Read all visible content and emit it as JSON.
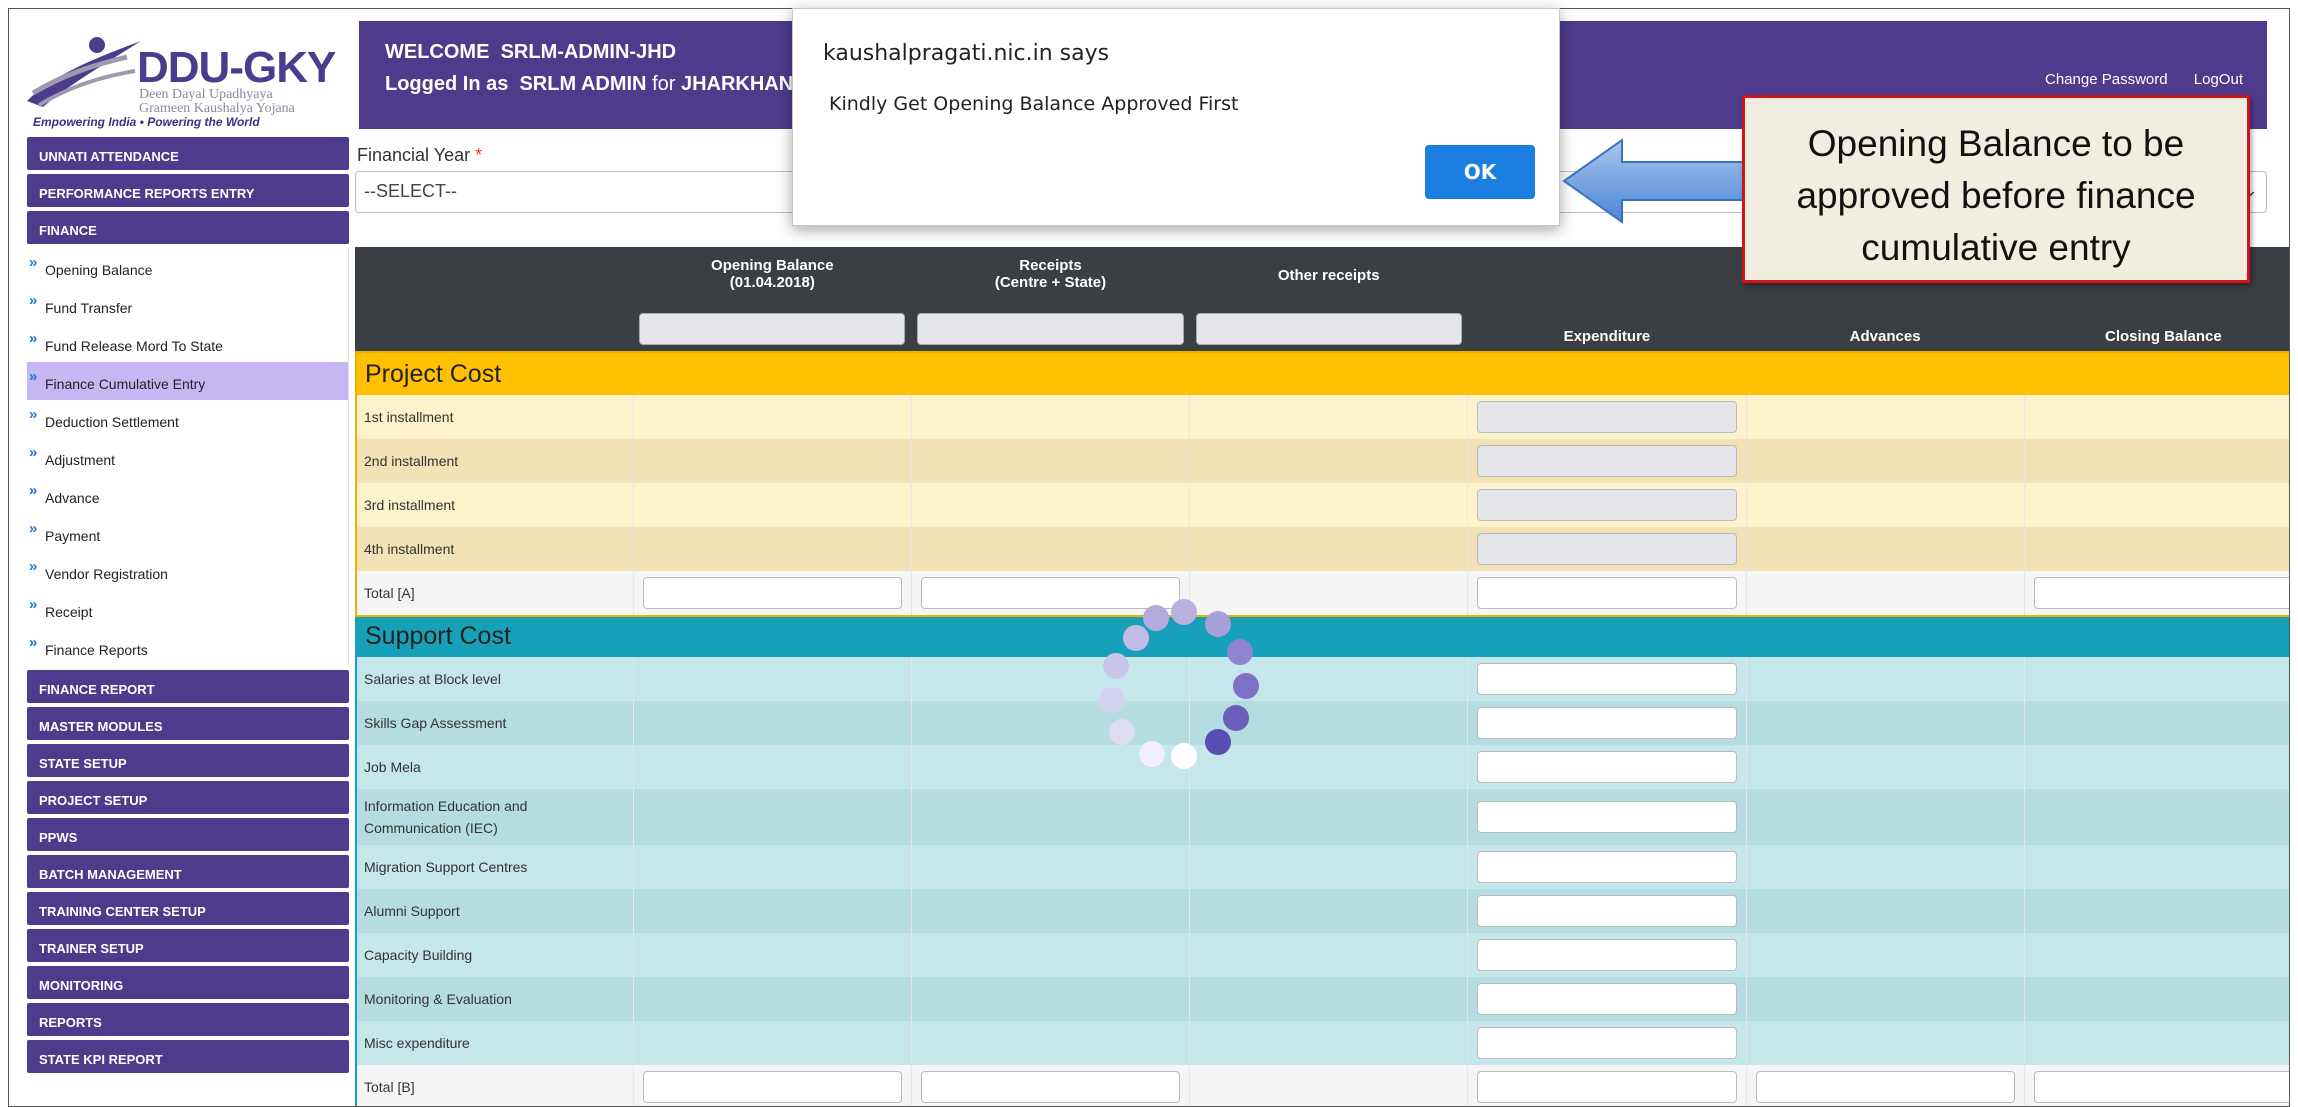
{
  "logo": {
    "brand": "DDU-GKY",
    "line1": "Deen Dayal Upadhyaya",
    "line2": "Grameen Kaushalya Yojana",
    "tagline": "Empowering India • Powering the World"
  },
  "header": {
    "welcome_label": "WELCOME",
    "welcome_user": "SRLM-ADMIN-JHD",
    "logged_label": "Logged In as",
    "logged_role": "SRLM ADMIN",
    "logged_for": "for",
    "logged_state": "JHARKHAN",
    "change_password": "Change Password",
    "logout": "LogOut"
  },
  "sidebar": {
    "top": [
      "UNNATI ATTENDANCE",
      "PERFORMANCE REPORTS ENTRY",
      "FINANCE"
    ],
    "finance_items": [
      "Opening Balance",
      "Fund Transfer",
      "Fund Release Mord To State",
      "Finance Cumulative Entry",
      "Deduction Settlement",
      "Adjustment",
      "Advance",
      "Payment",
      "Vendor Registration",
      "Receipt",
      "Finance Reports"
    ],
    "active_item": "Finance Cumulative Entry",
    "bottom": [
      "FINANCE REPORT",
      "MASTER MODULES",
      "STATE SETUP",
      "PROJECT SETUP",
      "PPWS",
      "BATCH MANAGEMENT",
      "TRAINING CENTER SETUP",
      "TRAINER SETUP",
      "MONITORING",
      "REPORTS",
      "STATE KPI REPORT"
    ]
  },
  "form": {
    "fy_label": "Financial Year",
    "fy_required": "*",
    "fy_value": "--SELECT--"
  },
  "table": {
    "headers": {
      "opening_l1": "Opening Balance",
      "opening_l2": "(01.04.2018)",
      "receipts_l1": "Receipts",
      "receipts_l2": "(Centre + State)",
      "other": "Other receipts",
      "expenditure": "Expenditure",
      "advances": "Advances",
      "closing": "Closing Balance"
    },
    "project_cost": {
      "title": "Project Cost",
      "rows": [
        "1st installment",
        "2nd installment",
        "3rd installment",
        "4th installment"
      ],
      "total": "Total [A]"
    },
    "support_cost": {
      "title": "Support Cost",
      "rows": [
        "Salaries at Block level",
        "Skills Gap Assessment",
        "Job Mela",
        "Information Education and Communication (IEC)",
        "Migration Support Centres",
        "Alumni Support",
        "Capacity Building",
        "Monitoring & Evaluation",
        "Misc expenditure"
      ],
      "total": "Total [B]"
    }
  },
  "dialog": {
    "title": "kaushalpragati.nic.in says",
    "message": "Kindly Get Opening Balance Approved First",
    "ok": "OK"
  },
  "annotation": {
    "line1": "Opening Balance to be",
    "line2": "approved before finance",
    "line3": "cumulative entry"
  },
  "colors": {
    "header_purple": "#4e3b8c",
    "project_cost_bar": "#ffc000",
    "support_cost_bar": "#17a1b8",
    "active_menu": "#c6b6f2",
    "ok_button": "#1a7fe0",
    "callout_border": "#d0121b"
  }
}
